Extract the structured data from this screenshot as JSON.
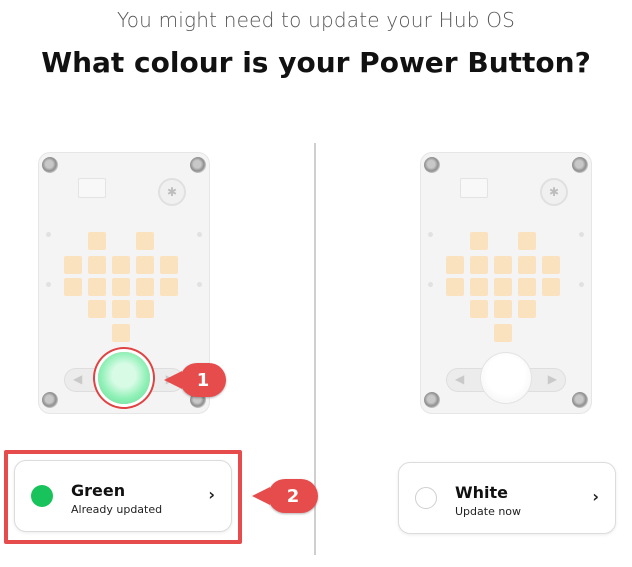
{
  "header": {
    "subtitle": "You might need to update your Hub OS",
    "title": "What colour is your Power Button?"
  },
  "options": [
    {
      "title": "Green",
      "subtitle": "Already updated",
      "swatch_color": "#17c35a",
      "icon": "chevron-right-icon"
    },
    {
      "title": "White",
      "subtitle": "Update now",
      "swatch_color": "#ffffff",
      "icon": "chevron-right-icon"
    }
  ],
  "callouts": [
    {
      "number": "1"
    },
    {
      "number": "2"
    }
  ],
  "colors": {
    "accent_red": "#e74c4c",
    "led_pixel": "#fbe2bf",
    "hub_body": "#f4f4f4"
  }
}
